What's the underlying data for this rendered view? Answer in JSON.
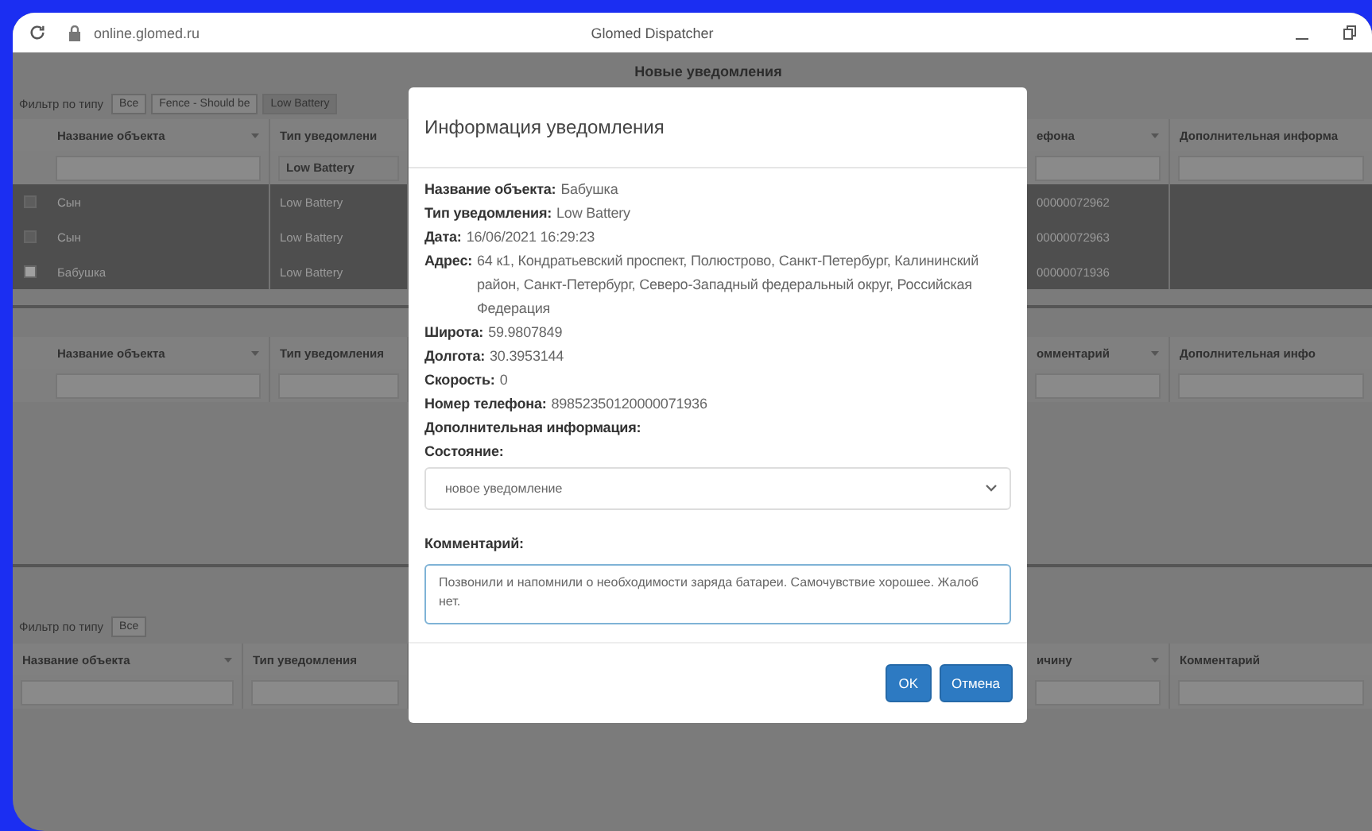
{
  "browser": {
    "url": "online.glomed.ru",
    "title": "Glomed Dispatcher"
  },
  "app": {
    "title": "Новые уведомления",
    "filter_label": "Фильтр по типу",
    "filters": [
      {
        "label": "Все",
        "selected": false
      },
      {
        "label": "Fence - Should be",
        "selected": false
      },
      {
        "label": "Low Battery",
        "selected": true
      }
    ],
    "table1": {
      "columns_left": [
        "Название объекта",
        "Тип уведомлени"
      ],
      "columns_right": [
        "ефона",
        "Дополнительная информа"
      ],
      "filter_value": "Low Battery",
      "rows": [
        {
          "name": "Сын",
          "type": "Low Battery",
          "phone": "00000072962",
          "selected": false
        },
        {
          "name": "Сын",
          "type": "Low Battery",
          "phone": "00000072963",
          "selected": false
        },
        {
          "name": "Бабушка",
          "type": "Low Battery",
          "phone": "00000071936",
          "selected": true
        }
      ]
    },
    "table2": {
      "columns_left": [
        "Название объекта",
        "Тип уведомления"
      ],
      "columns_right": [
        "омментарий",
        "Дополнительная инфо"
      ]
    },
    "filter2_label": "Фильтр по типу",
    "filters2": [
      {
        "label": "Все",
        "selected": false
      }
    ],
    "table3": {
      "columns_left": [
        "Название объекта",
        "Тип уведомления"
      ],
      "columns_right": [
        "ичину",
        "Комментарий"
      ]
    }
  },
  "modal": {
    "title": "Информация уведомления",
    "fields": [
      {
        "label": "Название объекта:",
        "value": "Бабушка"
      },
      {
        "label": "Тип уведомления:",
        "value": "Low Battery"
      },
      {
        "label": "Дата:",
        "value": "16/06/2021 16:29:23"
      },
      {
        "label": "Адрес:",
        "value": "64 к1, Кондратьевский проспект, Полюстрово, Санкт-Петербург, Калининский район, Санкт-Петербург, Северо-Западный федеральный округ, Российская Федерация"
      },
      {
        "label": "Широта:",
        "value": "59.9807849"
      },
      {
        "label": "Долгота:",
        "value": "30.3953144"
      },
      {
        "label": "Скорость:",
        "value": "0"
      },
      {
        "label": "Номер телефона:",
        "value": "89852350120000071936"
      },
      {
        "label": "Дополнительная информация:"
      }
    ],
    "state_label": "Состояние:",
    "state_value": "новое уведомление",
    "comment_label": "Комментарий:",
    "comment": "Позвонили и напомнили о необходимости заряда батареи. Самочувствие хорошее. Жалоб нет.",
    "buttons": [
      "OK",
      "Отмена"
    ]
  }
}
